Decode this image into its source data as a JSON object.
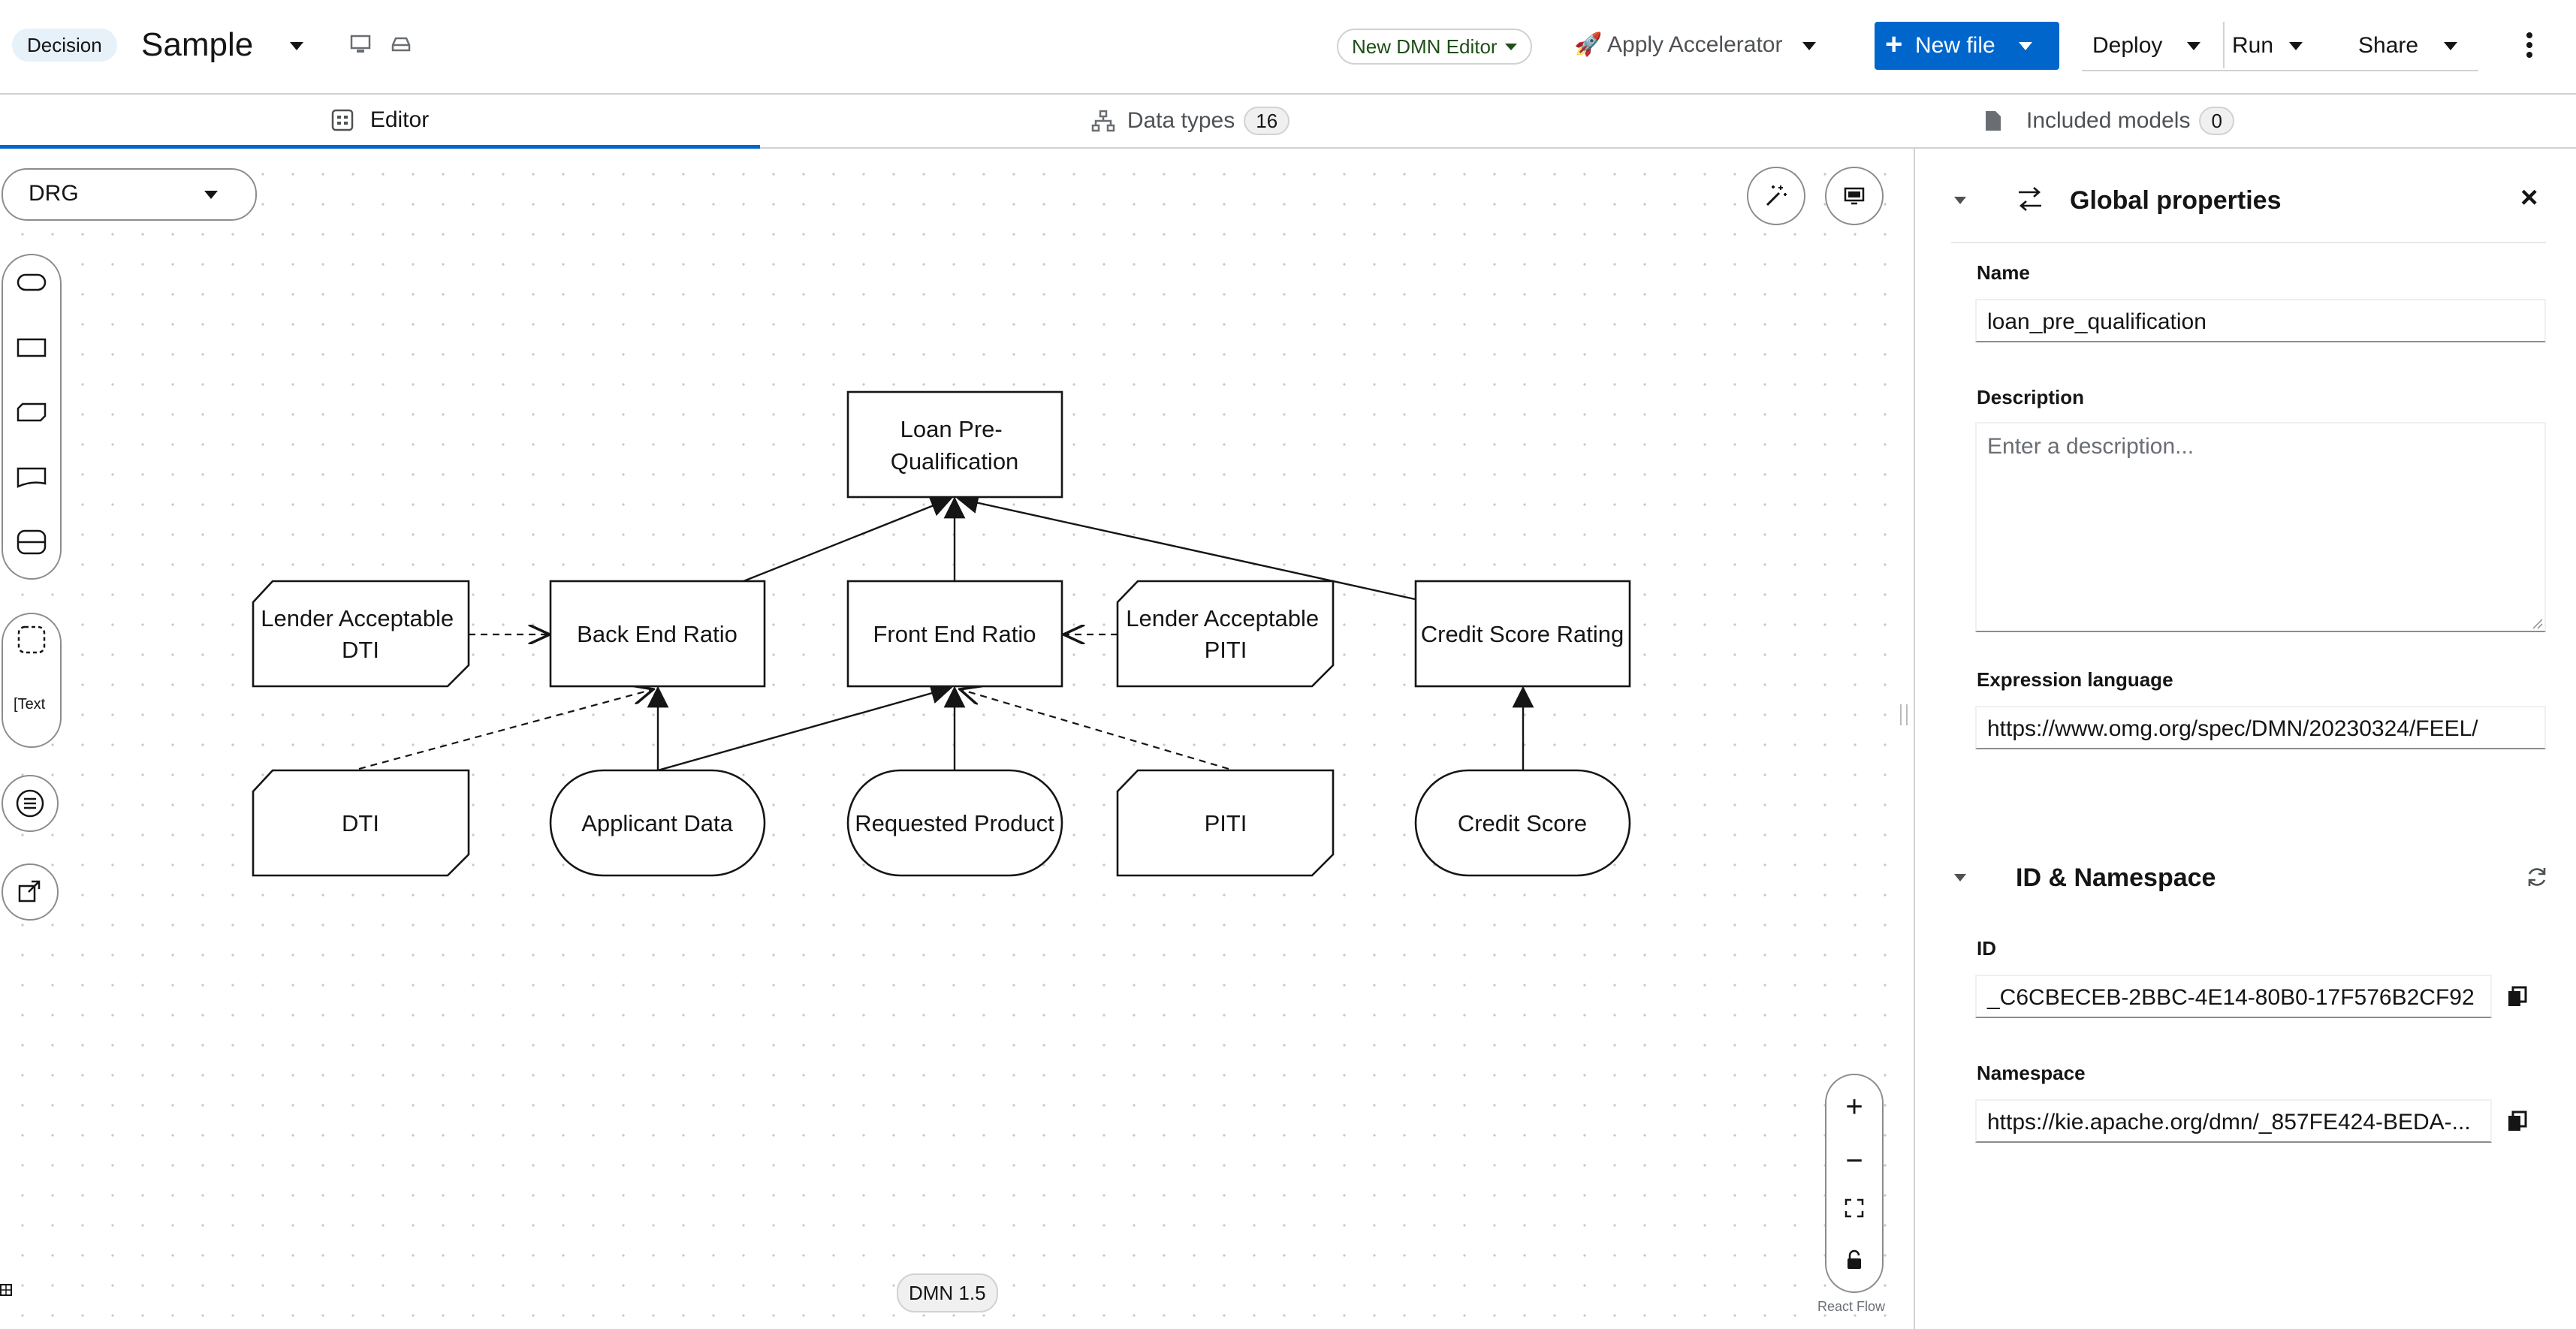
{
  "header": {
    "type_badge": "Decision",
    "file_name": "Sample",
    "editor_selector": "New DMN Editor",
    "accelerator": "Apply Accelerator",
    "new_file": "New file",
    "deploy": "Deploy",
    "run": "Run",
    "share": "Share"
  },
  "tabs": [
    {
      "label": "Editor"
    },
    {
      "label": "Data types",
      "count": "16"
    },
    {
      "label": "Included models",
      "count": "0"
    }
  ],
  "canvas": {
    "view_select": "DRG",
    "palette_text_tool": "Text",
    "dmn_version": "DMN 1.5",
    "attribution": "React Flow",
    "nodes": {
      "loan": "Loan Pre-\nQualification",
      "back_end": "Back End Ratio",
      "front_end": "Front End Ratio",
      "credit_rating": "Credit Score Rating",
      "lender_dti": "Lender Acceptable\nDTI",
      "lender_piti": "Lender Acceptable\nPITI",
      "dti": "DTI",
      "applicant": "Applicant Data",
      "requested": "Requested Product",
      "piti": "PITI",
      "credit_score": "Credit Score"
    }
  },
  "panel": {
    "global_title": "Global properties",
    "name_label": "Name",
    "name_value": "loan_pre_qualification",
    "description_label": "Description",
    "description_placeholder": "Enter a description...",
    "expr_label": "Expression language",
    "expr_value": "https://www.omg.org/spec/DMN/20230324/FEEL/",
    "id_section_title": "ID & Namespace",
    "id_label": "ID",
    "id_value": "_C6CBECEB-2BBC-4E14-80B0-17F576B2CF92",
    "namespace_label": "Namespace",
    "namespace_value": "https://kie.apache.org/dmn/_857FE424-BEDA-..."
  },
  "colors": {
    "accent": "#0066cc",
    "badge_bg": "#e7f1fa",
    "editor_pill": "#1e4f18"
  }
}
